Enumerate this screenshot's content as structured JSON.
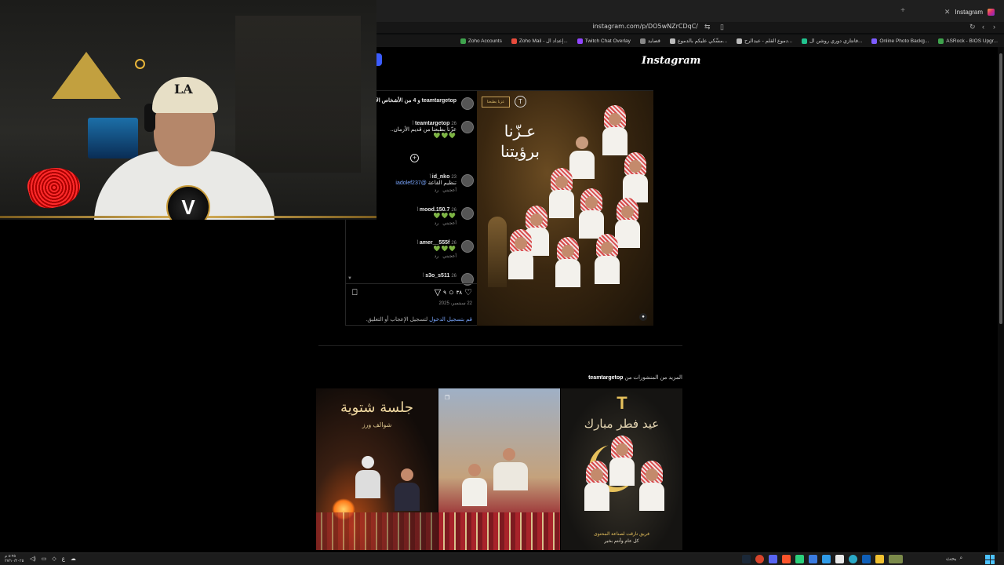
{
  "browser": {
    "tab_title": "Instagram",
    "url": "instagram.com/p/DO5wNZrCDqC/",
    "bookmarks": [
      {
        "label": "Zoho Accounts",
        "color": "#3fa34d"
      },
      {
        "label": "Zoho Mail - إعداد ال...",
        "color": "#e84b3c"
      },
      {
        "label": "Twitch Chat Overlay",
        "color": "#9146ff"
      },
      {
        "label": "قصايد",
        "color": "#888888"
      },
      {
        "label": "مسِّكي عليكم بالدموع...",
        "color": "#bbbbbb"
      },
      {
        "label": "دموع القلم - عبدالرح...",
        "color": "#bbbbbb"
      },
      {
        "label": "فانتازي دوري روشن ال...",
        "color": "#21c28e"
      },
      {
        "label": "Online Photo Backg...",
        "color": "#7d5cff"
      },
      {
        "label": "ASRock - BIOS Upgr...",
        "color": "#3fa34d"
      }
    ]
  },
  "page": {
    "logo": "Instagram"
  },
  "post": {
    "image_headline_line1": "عـزّنا",
    "image_headline_line2": "برؤيتنا",
    "image_logo_text": "عزنا بطبعنا",
    "author_header": "teamtargetop و 4 من الأشخاص الآخرين",
    "caption": {
      "username": "teamtargetop",
      "age": "26 أ",
      "text": "عزّنا بطبعنا من قديم الأزمان..",
      "hearts": "💚💚💚"
    },
    "comments": [
      {
        "username": "id_nko",
        "age": "23 أ",
        "text": "تنظيم القاعة",
        "mention": "@iadolef237",
        "likes_label": "أعجبني",
        "reply_label": "رد"
      },
      {
        "username": "mood.150.7",
        "age": "26 أ",
        "text": "",
        "hearts": "💚💚💚",
        "likes_label": "أعجبني",
        "reply_label": "رد"
      },
      {
        "username": "amer__555f",
        "age": "26 أ",
        "text": "",
        "hearts": "💚💚💚",
        "likes_label": "أعجبني",
        "reply_label": "رد"
      },
      {
        "username": "s3o_s511",
        "age": "26 أ"
      }
    ],
    "likes_count": "٣٨",
    "comments_count": "٩",
    "date": "22 سبتمبر، 2025",
    "login_link": "قم بتسجيل الدخول",
    "login_suffix": "لتسجيل الإعجاب أو التعليق."
  },
  "more_posts": {
    "title_prefix": "المزيد من المنشورات من",
    "username": "teamtargetop",
    "tiles": [
      {
        "title": "جلسة شتوية",
        "subtitle": "شوالف ورز"
      },
      {
        "title": "",
        "subtitle": ""
      },
      {
        "title": "عيد فطر مبارك",
        "subtitle_line1": "فريق تارقت لصناعة المحتوى",
        "subtitle_line2": "كل عام وأنتم بخير"
      }
    ]
  },
  "stream": {
    "cap_text": "LA",
    "overlay_logo": "V"
  },
  "taskbar": {
    "time": "٨:٢٥ م",
    "date": "٢٧/١٠/٢٠٢٥",
    "lang": "ع",
    "search_label": "بحث"
  }
}
